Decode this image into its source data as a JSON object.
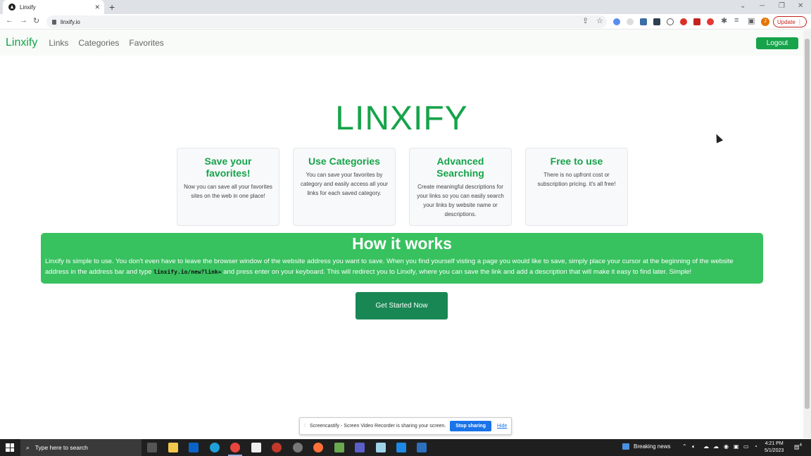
{
  "browser": {
    "tab_title": "Linxify",
    "url": "linxify.io",
    "update_label": "Update",
    "profile_initial": "J"
  },
  "nav": {
    "brand": "Linxify",
    "links": [
      "Links",
      "Categories",
      "Favorites"
    ],
    "logout_label": "Logout"
  },
  "hero": {
    "title": "LINXIFY"
  },
  "cards": [
    {
      "title": "Save your favorites!",
      "text": "Now you can save all your favorites sites on the web in one place!"
    },
    {
      "title": "Use Categories",
      "text": "You can save your favorites by category and easily access all your links for each saved category."
    },
    {
      "title": "Advanced Searching",
      "text": "Create meaningful descriptions for your links so you can easily search your links by website name or descriptions."
    },
    {
      "title": "Free to use",
      "text": "There is no upfront cost or subscription pricing. it's all free!"
    }
  ],
  "how": {
    "title": "How it works",
    "text_before": "Linxify is simple to use. You don't even have to leave the browser window of the website address you want to save. When you find yourself visting a page you would like to save, simply place your cursor at the beginning of the website address in the address bar and type ",
    "code": "linxify.io/new?link=",
    "text_after": " and press enter on your keyboard. This will redirect you to Linxify, where you can save the link and add a description that will make it easy to find later. Simple!"
  },
  "cta_label": "Get Started Now",
  "share_bar": {
    "message": "Screencastify - Screen Video Recorder is sharing your screen.",
    "stop_label": "Stop sharing",
    "hide_label": "Hide"
  },
  "taskbar": {
    "search_placeholder": "Type here to search",
    "news_label": "Breaking news",
    "time": "4:21 PM",
    "date": "5/1/2023",
    "notification_count": "4"
  },
  "colors": {
    "brand_green": "#16a34a",
    "banner_green": "#38c15f",
    "cta_green": "#198754"
  }
}
